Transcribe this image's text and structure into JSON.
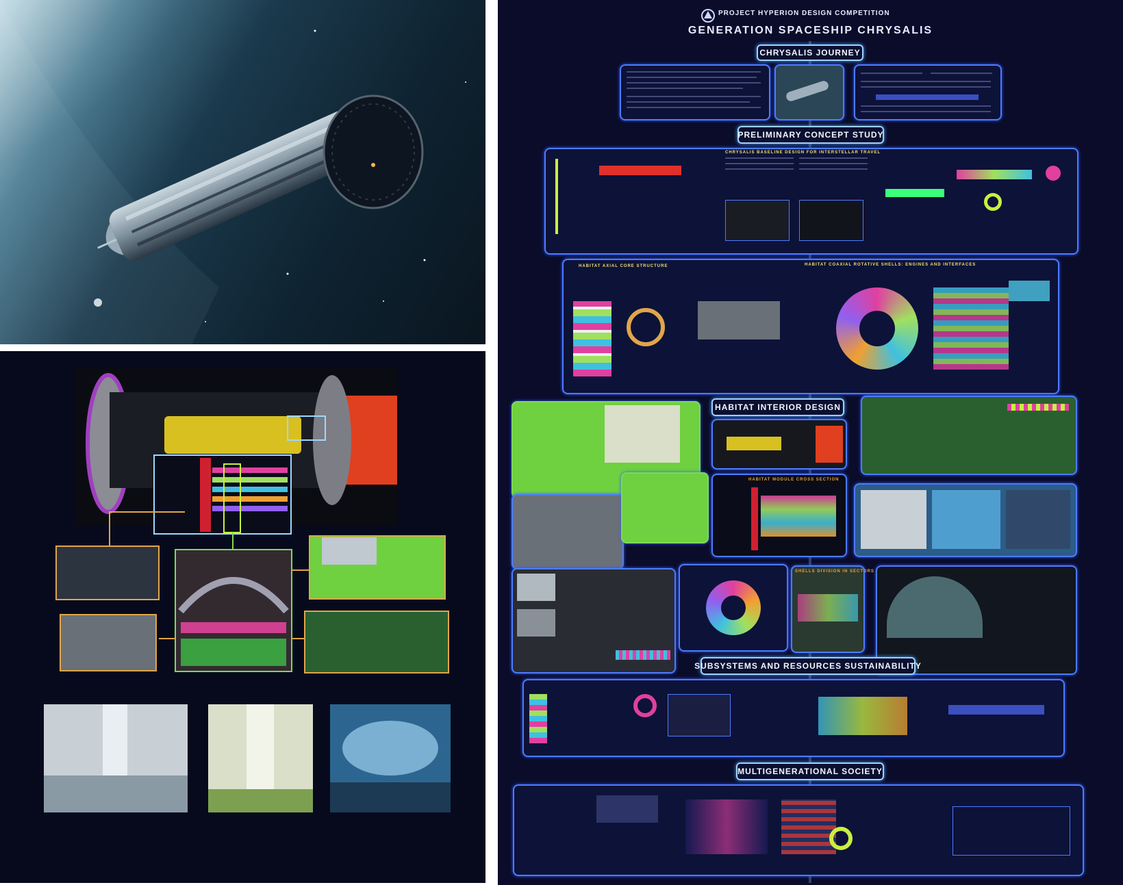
{
  "poster": {
    "header": "PROJECT HYPERION DESIGN COMPETITION",
    "title": "GENERATION SPACESHIP CHRYSALIS",
    "sections": {
      "journey": "CHRYSALIS JOURNEY",
      "concept": "PRELIMINARY CONCEPT STUDY",
      "interior": "HABITAT INTERIOR DESIGN",
      "subsystems": "SUBSYSTEMS AND RESOURCES SUSTAINABILITY",
      "society": "MULTIGENERATIONAL SOCIETY"
    },
    "sublabels": {
      "baseline": "CHRYSALIS BASELINE DESIGN FOR INTERSTELLAR TRAVEL",
      "axial": "HABITAT AXIAL CORE STRUCTURE",
      "coaxial": "HABITAT COAXIAL ROTATIVE SHELLS: ENGINES AND INTERFACES",
      "module_section": "HABITAT MODULE CROSS SECTION",
      "shells_division": "SHELLS DIVISION IN SECTORS"
    }
  },
  "colors": {
    "poster_bg": "#0a0c2a",
    "accent_blue": "#4d7bff",
    "accent_orange": "#e0a64a",
    "accent_red": "#e0302a",
    "accent_green": "#7ed957"
  },
  "icons": {
    "emblem": "emblem-icon"
  }
}
